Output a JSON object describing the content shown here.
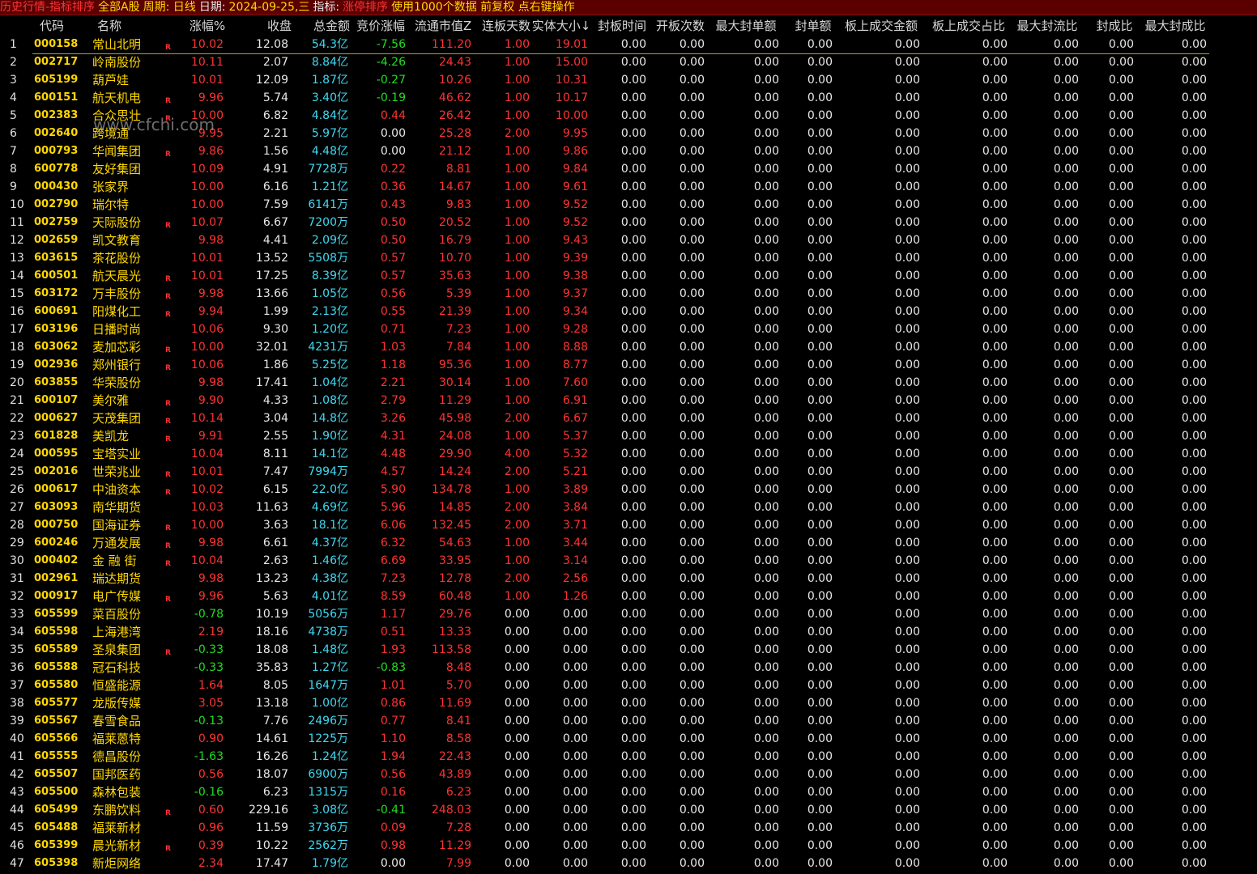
{
  "titlebar": {
    "mode": "历史行情-指标排序",
    "scope": "全部A股",
    "period": "周期: 日线",
    "date_label": "日期:",
    "date_value": "2024-09-25,三",
    "indicator_label": "指标:",
    "indicator_value": "涨停排序",
    "usage": "使用1000个数据 前复权 点右键操作"
  },
  "watermark": "www.cfchi.com",
  "columns": [
    "代码",
    "名称",
    "涨幅%",
    "收盘",
    "总金额",
    "竞价涨幅",
    "流通市值Z",
    "连板天数",
    "实体大小↓",
    "封板时间",
    "开板次数",
    "最大封单额",
    "封单额",
    "板上成交金额",
    "板上成交占比",
    "最大封流比",
    "封成比",
    "最大封成比"
  ],
  "zero_value": "0.00",
  "rows": [
    {
      "n": "1",
      "code": "000158",
      "name": "常山北明",
      "r": "R",
      "chg": "10.02",
      "close": "12.08",
      "amt": "54.3亿",
      "bid": "-7.56",
      "mcap": "111.20",
      "streak": "1.00",
      "body": "19.01"
    },
    {
      "n": "2",
      "code": "002717",
      "name": "岭南股份",
      "r": "",
      "chg": "10.11",
      "close": "2.07",
      "amt": "8.84亿",
      "bid": "-4.26",
      "mcap": "24.43",
      "streak": "1.00",
      "body": "15.00"
    },
    {
      "n": "3",
      "code": "605199",
      "name": "葫芦娃",
      "r": "",
      "chg": "10.01",
      "close": "12.09",
      "amt": "1.87亿",
      "bid": "-0.27",
      "mcap": "10.26",
      "streak": "1.00",
      "body": "10.31"
    },
    {
      "n": "4",
      "code": "600151",
      "name": "航天机电",
      "r": "R",
      "chg": "9.96",
      "close": "5.74",
      "amt": "3.40亿",
      "bid": "-0.19",
      "mcap": "46.62",
      "streak": "1.00",
      "body": "10.17"
    },
    {
      "n": "5",
      "code": "002383",
      "name": "合众思壮",
      "r": "R",
      "chg": "10.00",
      "close": "6.82",
      "amt": "4.84亿",
      "bid": "0.44",
      "mcap": "26.42",
      "streak": "1.00",
      "body": "10.00"
    },
    {
      "n": "6",
      "code": "002640",
      "name": "跨境通",
      "r": "",
      "chg": "9.95",
      "close": "2.21",
      "amt": "5.97亿",
      "bid": "0.00",
      "mcap": "25.28",
      "streak": "2.00",
      "body": "9.95"
    },
    {
      "n": "7",
      "code": "000793",
      "name": "华闻集团",
      "r": "R",
      "chg": "9.86",
      "close": "1.56",
      "amt": "4.48亿",
      "bid": "0.00",
      "mcap": "21.12",
      "streak": "1.00",
      "body": "9.86"
    },
    {
      "n": "8",
      "code": "600778",
      "name": "友好集团",
      "r": "",
      "chg": "10.09",
      "close": "4.91",
      "amt": "7728万",
      "bid": "0.22",
      "mcap": "8.81",
      "streak": "1.00",
      "body": "9.84"
    },
    {
      "n": "9",
      "code": "000430",
      "name": "张家界",
      "r": "",
      "chg": "10.00",
      "close": "6.16",
      "amt": "1.21亿",
      "bid": "0.36",
      "mcap": "14.67",
      "streak": "1.00",
      "body": "9.61"
    },
    {
      "n": "10",
      "code": "002790",
      "name": "瑞尔特",
      "r": "",
      "chg": "10.00",
      "close": "7.59",
      "amt": "6141万",
      "bid": "0.43",
      "mcap": "9.83",
      "streak": "1.00",
      "body": "9.52"
    },
    {
      "n": "11",
      "code": "002759",
      "name": "天际股份",
      "r": "R",
      "chg": "10.07",
      "close": "6.67",
      "amt": "7200万",
      "bid": "0.50",
      "mcap": "20.52",
      "streak": "1.00",
      "body": "9.52"
    },
    {
      "n": "12",
      "code": "002659",
      "name": "凯文教育",
      "r": "",
      "chg": "9.98",
      "close": "4.41",
      "amt": "2.09亿",
      "bid": "0.50",
      "mcap": "16.79",
      "streak": "1.00",
      "body": "9.43"
    },
    {
      "n": "13",
      "code": "603615",
      "name": "茶花股份",
      "r": "",
      "chg": "10.01",
      "close": "13.52",
      "amt": "5508万",
      "bid": "0.57",
      "mcap": "10.70",
      "streak": "1.00",
      "body": "9.39"
    },
    {
      "n": "14",
      "code": "600501",
      "name": "航天晨光",
      "r": "R",
      "chg": "10.01",
      "close": "17.25",
      "amt": "8.39亿",
      "bid": "0.57",
      "mcap": "35.63",
      "streak": "1.00",
      "body": "9.38"
    },
    {
      "n": "15",
      "code": "603172",
      "name": "万丰股份",
      "r": "R",
      "chg": "9.98",
      "close": "13.66",
      "amt": "1.05亿",
      "bid": "0.56",
      "mcap": "5.39",
      "streak": "1.00",
      "body": "9.37"
    },
    {
      "n": "16",
      "code": "600691",
      "name": "阳煤化工",
      "r": "R",
      "chg": "9.94",
      "close": "1.99",
      "amt": "2.13亿",
      "bid": "0.55",
      "mcap": "21.39",
      "streak": "1.00",
      "body": "9.34"
    },
    {
      "n": "17",
      "code": "603196",
      "name": "日播时尚",
      "r": "",
      "chg": "10.06",
      "close": "9.30",
      "amt": "1.20亿",
      "bid": "0.71",
      "mcap": "7.23",
      "streak": "1.00",
      "body": "9.28"
    },
    {
      "n": "18",
      "code": "603062",
      "name": "麦加芯彩",
      "r": "R",
      "chg": "10.00",
      "close": "32.01",
      "amt": "4231万",
      "bid": "1.03",
      "mcap": "7.84",
      "streak": "1.00",
      "body": "8.88"
    },
    {
      "n": "19",
      "code": "002936",
      "name": "郑州银行",
      "r": "R",
      "chg": "10.06",
      "close": "1.86",
      "amt": "5.25亿",
      "bid": "1.18",
      "mcap": "95.36",
      "streak": "1.00",
      "body": "8.77"
    },
    {
      "n": "20",
      "code": "603855",
      "name": "华荣股份",
      "r": "",
      "chg": "9.98",
      "close": "17.41",
      "amt": "1.04亿",
      "bid": "2.21",
      "mcap": "30.14",
      "streak": "1.00",
      "body": "7.60"
    },
    {
      "n": "21",
      "code": "600107",
      "name": "美尔雅",
      "r": "R",
      "chg": "9.90",
      "close": "4.33",
      "amt": "1.08亿",
      "bid": "2.79",
      "mcap": "11.29",
      "streak": "1.00",
      "body": "6.91"
    },
    {
      "n": "22",
      "code": "000627",
      "name": "天茂集团",
      "r": "R",
      "chg": "10.14",
      "close": "3.04",
      "amt": "14.8亿",
      "bid": "3.26",
      "mcap": "45.98",
      "streak": "2.00",
      "body": "6.67"
    },
    {
      "n": "23",
      "code": "601828",
      "name": "美凯龙",
      "r": "R",
      "chg": "9.91",
      "close": "2.55",
      "amt": "1.90亿",
      "bid": "4.31",
      "mcap": "24.08",
      "streak": "1.00",
      "body": "5.37"
    },
    {
      "n": "24",
      "code": "000595",
      "name": "宝塔实业",
      "r": "",
      "chg": "10.04",
      "close": "8.11",
      "amt": "14.1亿",
      "bid": "4.48",
      "mcap": "29.90",
      "streak": "4.00",
      "body": "5.32"
    },
    {
      "n": "25",
      "code": "002016",
      "name": "世荣兆业",
      "r": "R",
      "chg": "10.01",
      "close": "7.47",
      "amt": "7994万",
      "bid": "4.57",
      "mcap": "14.24",
      "streak": "2.00",
      "body": "5.21"
    },
    {
      "n": "26",
      "code": "000617",
      "name": "中油资本",
      "r": "R",
      "chg": "10.02",
      "close": "6.15",
      "amt": "22.0亿",
      "bid": "5.90",
      "mcap": "134.78",
      "streak": "1.00",
      "body": "3.89"
    },
    {
      "n": "27",
      "code": "603093",
      "name": "南华期货",
      "r": "",
      "chg": "10.03",
      "close": "11.63",
      "amt": "4.69亿",
      "bid": "5.96",
      "mcap": "14.85",
      "streak": "2.00",
      "body": "3.84"
    },
    {
      "n": "28",
      "code": "000750",
      "name": "国海证券",
      "r": "R",
      "chg": "10.00",
      "close": "3.63",
      "amt": "18.1亿",
      "bid": "6.06",
      "mcap": "132.45",
      "streak": "2.00",
      "body": "3.71"
    },
    {
      "n": "29",
      "code": "600246",
      "name": "万通发展",
      "r": "R",
      "chg": "9.98",
      "close": "6.61",
      "amt": "4.37亿",
      "bid": "6.32",
      "mcap": "54.63",
      "streak": "1.00",
      "body": "3.44"
    },
    {
      "n": "30",
      "code": "000402",
      "name": "金 融 街",
      "r": "R",
      "chg": "10.04",
      "close": "2.63",
      "amt": "1.46亿",
      "bid": "6.69",
      "mcap": "33.95",
      "streak": "1.00",
      "body": "3.14"
    },
    {
      "n": "31",
      "code": "002961",
      "name": "瑞达期货",
      "r": "",
      "chg": "9.98",
      "close": "13.23",
      "amt": "4.38亿",
      "bid": "7.23",
      "mcap": "12.78",
      "streak": "2.00",
      "body": "2.56"
    },
    {
      "n": "32",
      "code": "000917",
      "name": "电广传媒",
      "r": "R",
      "chg": "9.96",
      "close": "5.63",
      "amt": "4.01亿",
      "bid": "8.59",
      "mcap": "60.48",
      "streak": "1.00",
      "body": "1.26"
    },
    {
      "n": "33",
      "code": "605599",
      "name": "菜百股份",
      "r": "",
      "chg": "-0.78",
      "close": "10.19",
      "amt": "5056万",
      "bid": "1.17",
      "mcap": "29.76",
      "streak": "0.00",
      "body": "0.00"
    },
    {
      "n": "34",
      "code": "605598",
      "name": "上海港湾",
      "r": "",
      "chg": "2.19",
      "close": "18.16",
      "amt": "4738万",
      "bid": "0.51",
      "mcap": "13.33",
      "streak": "0.00",
      "body": "0.00"
    },
    {
      "n": "35",
      "code": "605589",
      "name": "圣泉集团",
      "r": "R",
      "chg": "-0.33",
      "close": "18.08",
      "amt": "1.48亿",
      "bid": "1.93",
      "mcap": "113.58",
      "streak": "0.00",
      "body": "0.00"
    },
    {
      "n": "36",
      "code": "605588",
      "name": "冠石科技",
      "r": "",
      "chg": "-0.33",
      "close": "35.83",
      "amt": "1.27亿",
      "bid": "-0.83",
      "mcap": "8.48",
      "streak": "0.00",
      "body": "0.00"
    },
    {
      "n": "37",
      "code": "605580",
      "name": "恒盛能源",
      "r": "",
      "chg": "1.64",
      "close": "8.05",
      "amt": "1647万",
      "bid": "1.01",
      "mcap": "5.70",
      "streak": "0.00",
      "body": "0.00"
    },
    {
      "n": "38",
      "code": "605577",
      "name": "龙版传媒",
      "r": "",
      "chg": "3.05",
      "close": "13.18",
      "amt": "1.00亿",
      "bid": "0.86",
      "mcap": "11.69",
      "streak": "0.00",
      "body": "0.00"
    },
    {
      "n": "39",
      "code": "605567",
      "name": "春雪食品",
      "r": "",
      "chg": "-0.13",
      "close": "7.76",
      "amt": "2496万",
      "bid": "0.77",
      "mcap": "8.41",
      "streak": "0.00",
      "body": "0.00"
    },
    {
      "n": "40",
      "code": "605566",
      "name": "福莱蒽特",
      "r": "",
      "chg": "0.90",
      "close": "14.61",
      "amt": "1225万",
      "bid": "1.10",
      "mcap": "8.58",
      "streak": "0.00",
      "body": "0.00"
    },
    {
      "n": "41",
      "code": "605555",
      "name": "德昌股份",
      "r": "",
      "chg": "-1.63",
      "close": "16.26",
      "amt": "1.24亿",
      "bid": "1.94",
      "mcap": "22.43",
      "streak": "0.00",
      "body": "0.00"
    },
    {
      "n": "42",
      "code": "605507",
      "name": "国邦医药",
      "r": "",
      "chg": "0.56",
      "close": "18.07",
      "amt": "6900万",
      "bid": "0.56",
      "mcap": "43.89",
      "streak": "0.00",
      "body": "0.00"
    },
    {
      "n": "43",
      "code": "605500",
      "name": "森林包装",
      "r": "",
      "chg": "-0.16",
      "close": "6.23",
      "amt": "1315万",
      "bid": "0.16",
      "mcap": "6.23",
      "streak": "0.00",
      "body": "0.00"
    },
    {
      "n": "44",
      "code": "605499",
      "name": "东鹏饮料",
      "r": "R",
      "chg": "0.60",
      "close": "229.16",
      "amt": "3.08亿",
      "bid": "-0.41",
      "mcap": "248.03",
      "streak": "0.00",
      "body": "0.00"
    },
    {
      "n": "45",
      "code": "605488",
      "name": "福莱新材",
      "r": "",
      "chg": "0.96",
      "close": "11.59",
      "amt": "3736万",
      "bid": "0.09",
      "mcap": "7.28",
      "streak": "0.00",
      "body": "0.00"
    },
    {
      "n": "46",
      "code": "605399",
      "name": "晨光新材",
      "r": "R",
      "chg": "0.39",
      "close": "10.22",
      "amt": "2562万",
      "bid": "0.98",
      "mcap": "11.29",
      "streak": "0.00",
      "body": "0.00"
    },
    {
      "n": "47",
      "code": "605398",
      "name": "新炬网络",
      "r": "",
      "chg": "2.34",
      "close": "17.47",
      "amt": "1.79亿",
      "bid": "0.00",
      "mcap": "7.99",
      "streak": "0.00",
      "body": "0.00"
    }
  ]
}
